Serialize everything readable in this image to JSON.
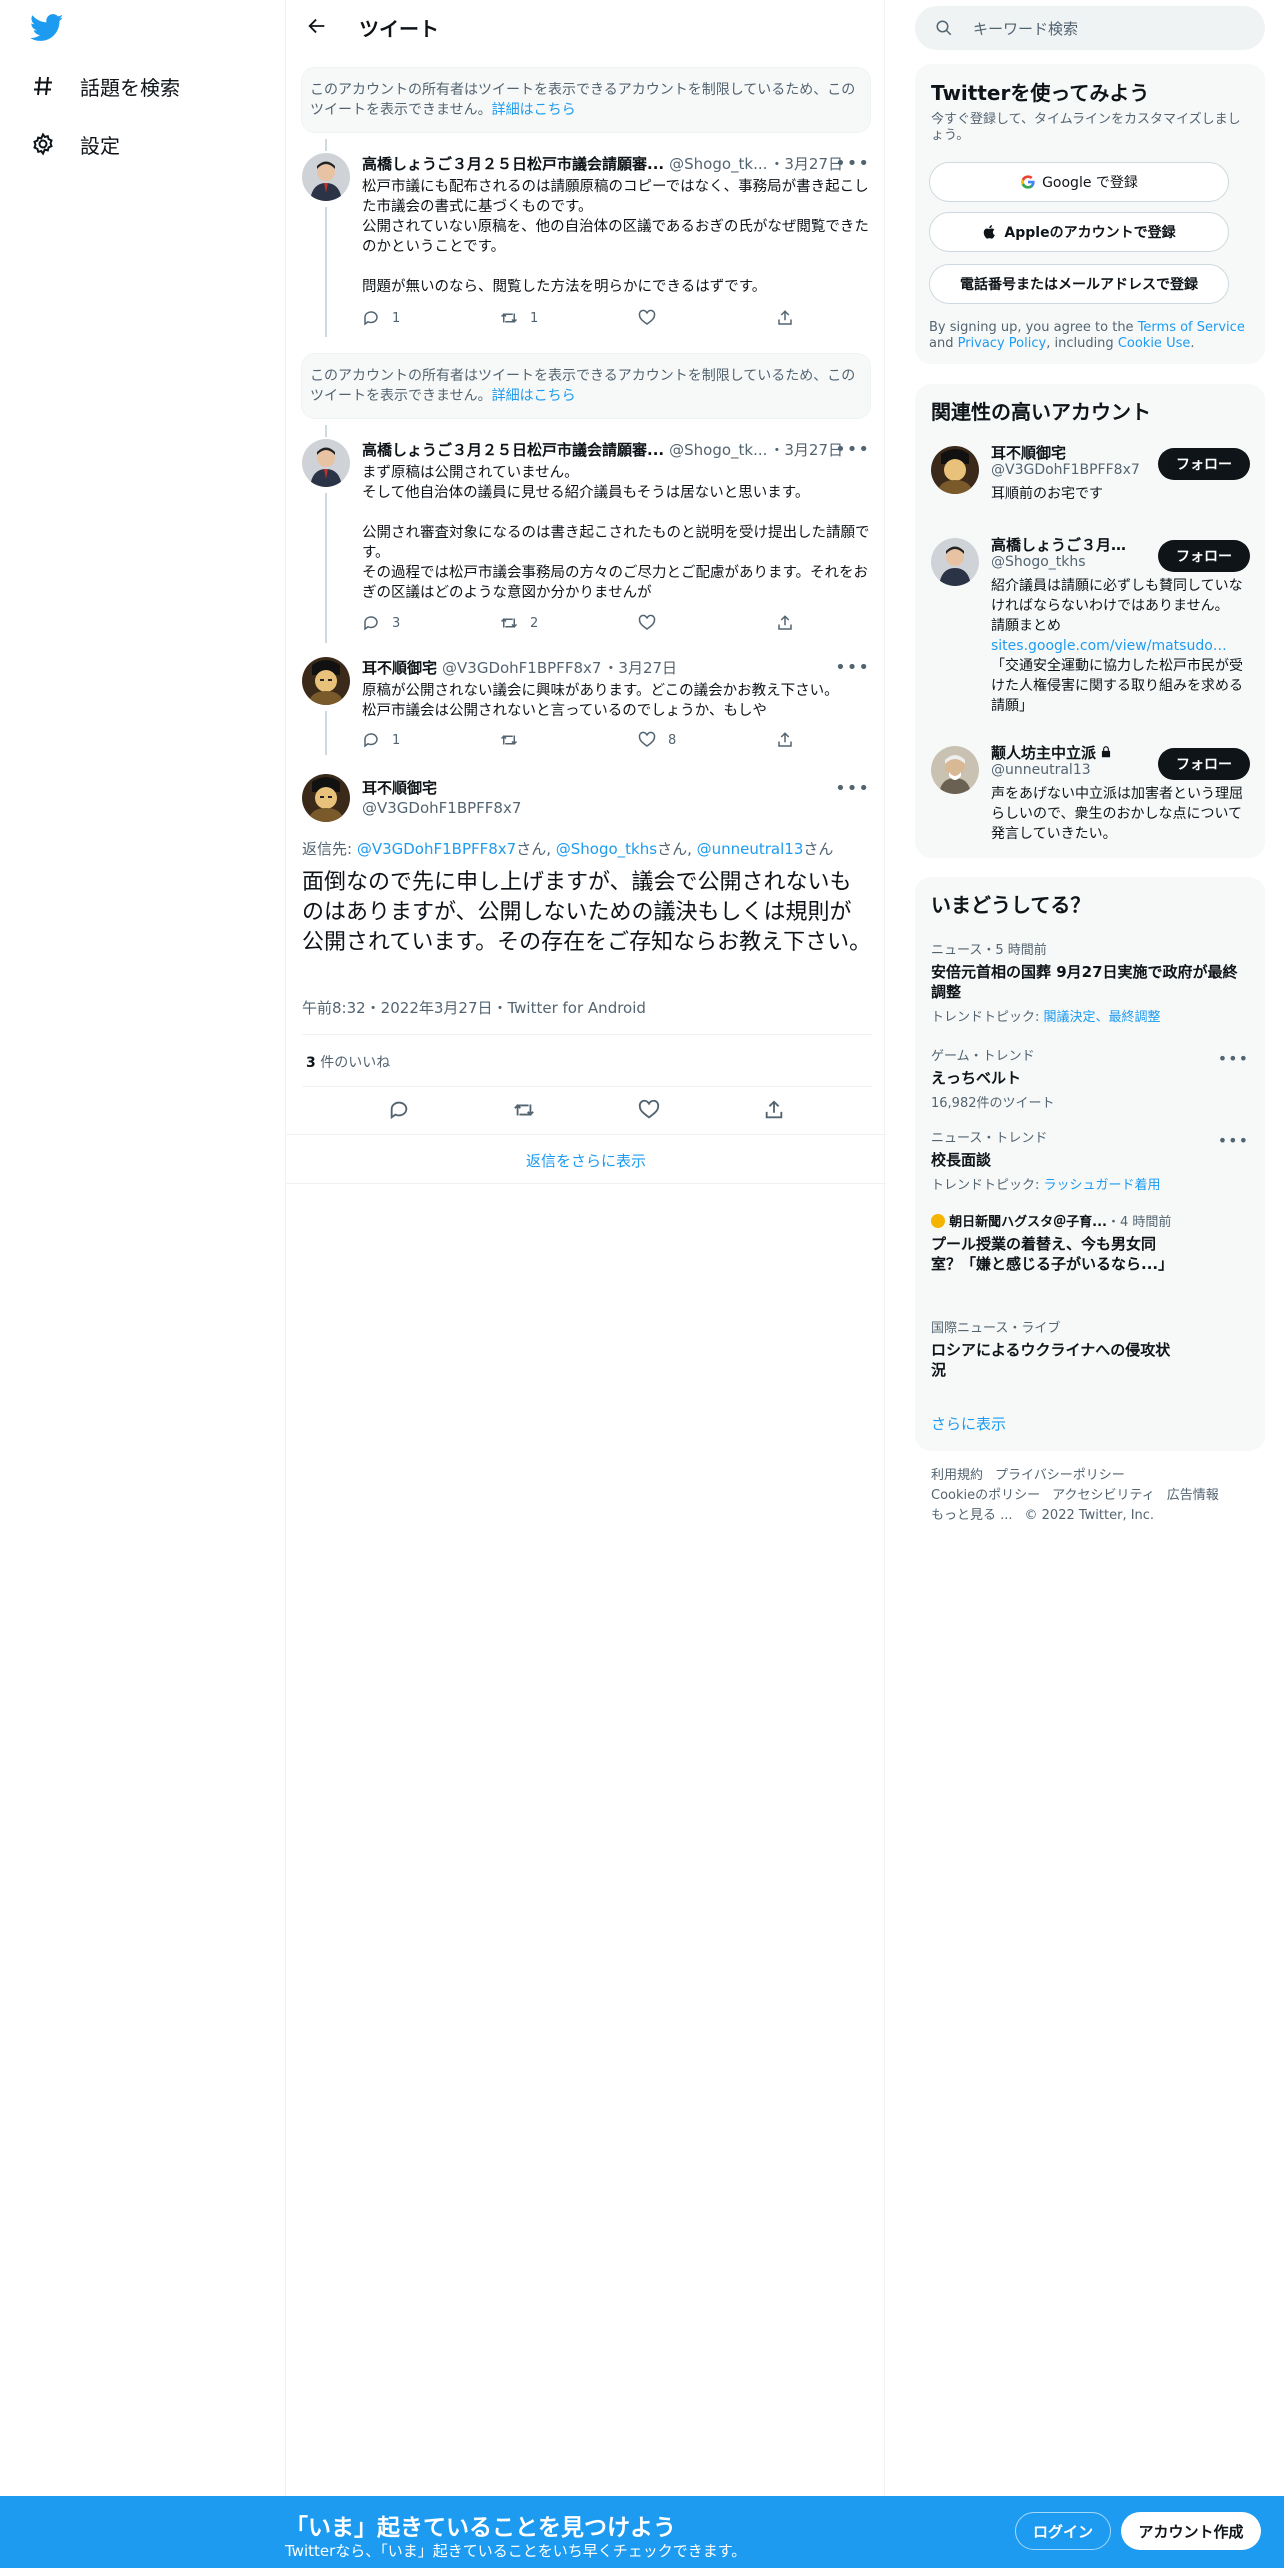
{
  "nav": {
    "explore": "話題を検索",
    "settings": "設定"
  },
  "header": {
    "title": "ツイート"
  },
  "notice": {
    "text": "このアカウントの所有者はツイートを表示できるアカウントを制限しているため、このツイートを表示できません。",
    "link": "詳細はこちら"
  },
  "tweets": [
    {
      "name": "高橋しょうご３月２５日松戸市議会請願審...",
      "handle": "@Shogo_tk...",
      "date": "・3月27日",
      "text": "松戸市議にも配布されるのは請願原稿のコピーではなく、事務局が書き起こした市議会の書式に基づくものです。\n公開されていない原稿を、他の自治体の区議であるおぎの氏がなぜ閲覧できたのかということです。\n\n問題が無いのなら、閲覧した方法を明らかにできるはずです。",
      "replies": "1",
      "retweets": "1",
      "likes": ""
    },
    {
      "name": "高橋しょうご３月２５日松戸市議会請願審...",
      "handle": "@Shogo_tk...",
      "date": "・3月27日",
      "text": "まず原稿は公開されていません。\nそして他自治体の議員に見せる紹介議員もそうは居ないと思います。\n\n公開され審査対象になるのは書き起こされたものと説明を受け提出した請願です。\nその過程では松戸市議会事務局の方々のご尽力とご配慮があります。それをおぎの区議はどのような意図か分かりませんが",
      "replies": "3",
      "retweets": "2",
      "likes": ""
    },
    {
      "name": "耳不順御宅",
      "handle": "@V3GDohF1BPFF8x7",
      "date": "・3月27日",
      "text": "原稿が公開されない議会に興味があります。どこの議会かお教え下さい。\n松戸市議会は公開されないと言っているのでしょうか、もしや",
      "replies": "1",
      "retweets": "",
      "likes": "8"
    }
  ],
  "main_tweet": {
    "name": "耳不順御宅",
    "handle": "@V3GDohF1BPFF8x7",
    "reply_prefix": "返信先: ",
    "reply_to_1": "@V3GDohF1BPFF8x7",
    "reply_sep_1": "さん, ",
    "reply_to_2": "@Shogo_tkhs",
    "reply_sep_2": "さん, ",
    "reply_to_3": "@unneutral13",
    "reply_sep_3": "さん",
    "text": "面倒なので先に申し上げますが、議会で公開されないものはありますが、公開しないための議決もしくは規則が公開されています。その存在をご存知ならお教え下さい。",
    "meta": "午前8:32・2022年3月27日・Twitter for Android",
    "like_count": "3",
    "like_label": " 件のいいね"
  },
  "show_more_replies": "返信をさらに表示",
  "search": {
    "placeholder": "キーワード検索"
  },
  "signup_card": {
    "title": "Twitterを使ってみよう",
    "subtitle": "今すぐ登録して、タイムラインをカスタマイズしましょう。",
    "google": "Google で登録",
    "apple": "Appleのアカウントで登録",
    "phone": "電話番号またはメールアドレスで登録",
    "terms_1": "By signing up, you agree to the ",
    "terms_tos": "Terms of Service",
    "terms_2": " and ",
    "terms_privacy": "Privacy Policy",
    "terms_3": ", including ",
    "terms_cookie": "Cookie Use",
    "terms_4": "."
  },
  "related": {
    "title": "関連性の高いアカウント",
    "follow_label": "フォロー",
    "accounts": [
      {
        "name": "耳不順御宅",
        "handle": "@V3GDohF1BPFF8x7",
        "bio": "耳順前のお宅です"
      },
      {
        "name": "高橋しょうご３月２...",
        "handle": "@Shogo_tkhs",
        "bio": "紹介議員は請願に必ずしも賛同していなければならないわけではありません。　　請願まとめ",
        "link": "sites.google.com/view/matsudovt...",
        "bio2": "「交通安全運動に協力した松戸市民が受けた人権侵害に関する取り組みを求める請願」"
      },
      {
        "name": "颟人坊主中立派",
        "handle": "@unneutral13",
        "bio": "声をあげない中立派は加害者という理屈らしいので、衆生のおかしな点について発言していきたい。"
      }
    ]
  },
  "trends": {
    "title": "いまどうしてる？",
    "items": [
      {
        "meta": "ニュース・5 時間前",
        "title": "安倍元首相の国葬 9月27日実施で政府が最終調整",
        "sub_prefix": "トレンドトピック: ",
        "sub_links": "閣議決定、最終調整"
      },
      {
        "meta": "ゲーム・トレンド",
        "title": "えっちベルト",
        "sub": "16,982件のツイート"
      },
      {
        "meta": "ニュース・トレンド",
        "title": "校長面談",
        "sub_prefix": "トレンドトピック: ",
        "sub_links": "ラッシュガード着用"
      },
      {
        "meta_source": "朝日新聞ハグスタ＠子育...",
        "meta": "・4 時間前",
        "title": "プール授業の着替え、今も男女同室？「嫌と感じる子がいるなら...」"
      },
      {
        "meta": "国際ニュース・ライブ",
        "title": "ロシアによるウクライナへの侵攻状況"
      }
    ],
    "show_more": "さらに表示"
  },
  "footer": {
    "terms": "利用規約",
    "privacy": "プライバシーポリシー",
    "cookie": "Cookieのポリシー",
    "accessibility": "アクセシビリティ",
    "ads": "広告情報",
    "more": "もっと見る ...",
    "copyright": "© 2022 Twitter, Inc."
  },
  "bottom_bar": {
    "title": "「いま」起きていることを見つけよう",
    "subtitle": "Twitterなら、「いま」起きていることをいち早くチェックできます。",
    "login": "ログイン",
    "signup": "アカウント作成"
  },
  "colors": {
    "accent": "#1d9bf0",
    "text": "#0f1419",
    "secondary": "#536471"
  }
}
